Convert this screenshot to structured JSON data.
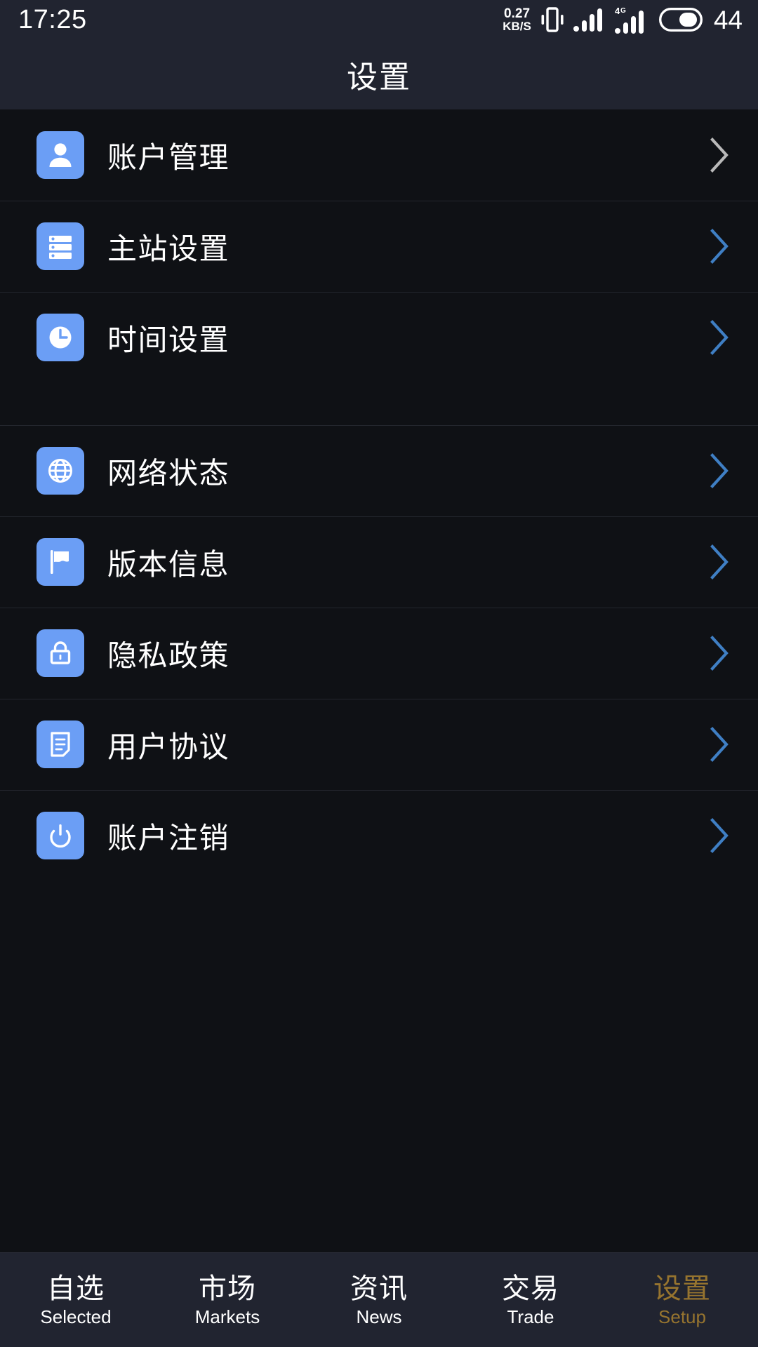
{
  "status_bar": {
    "time": "17:25",
    "net_speed_value": "0.27",
    "net_speed_unit": "KB/S",
    "vibrate_icon": "vibrate-icon",
    "signal_icon": "signal-bars-icon",
    "network_type": "4G",
    "network_icon": "signal-bars-4g-icon",
    "battery_icon": "battery-icon",
    "battery_level": "44"
  },
  "header": {
    "title": "设置"
  },
  "colors": {
    "icon_tile": "#6b9ef5",
    "chevron_blue": "#3f7fc4",
    "chevron_gray": "#b9b9b9",
    "active_tab": "#96742f",
    "header_bg": "#212430",
    "content_bg": "#0f1115",
    "divider": "#23262d"
  },
  "sections": [
    {
      "rows": [
        {
          "icon": "user-icon",
          "label": "账户管理",
          "chevron_color": "#b9b9b9"
        },
        {
          "icon": "server-icon",
          "label": "主站设置",
          "chevron_color": "#3f7fc4"
        },
        {
          "icon": "clock-icon",
          "label": "时间设置",
          "chevron_color": "#3f7fc4"
        }
      ]
    },
    {
      "rows": [
        {
          "icon": "globe-icon",
          "label": "网络状态",
          "chevron_color": "#3f7fc4"
        },
        {
          "icon": "flag-icon",
          "label": "版本信息",
          "chevron_color": "#3f7fc4"
        },
        {
          "icon": "lock-icon",
          "label": "隐私政策",
          "chevron_color": "#3f7fc4"
        },
        {
          "icon": "document-icon",
          "label": "用户协议",
          "chevron_color": "#3f7fc4"
        },
        {
          "icon": "power-icon",
          "label": "账户注销",
          "chevron_color": "#3f7fc4"
        }
      ]
    }
  ],
  "tabbar": {
    "tabs": [
      {
        "cn": "自选",
        "en": "Selected",
        "active": false
      },
      {
        "cn": "市场",
        "en": "Markets",
        "active": false
      },
      {
        "cn": "资讯",
        "en": "News",
        "active": false
      },
      {
        "cn": "交易",
        "en": "Trade",
        "active": false
      },
      {
        "cn": "设置",
        "en": "Setup",
        "active": true
      }
    ]
  }
}
